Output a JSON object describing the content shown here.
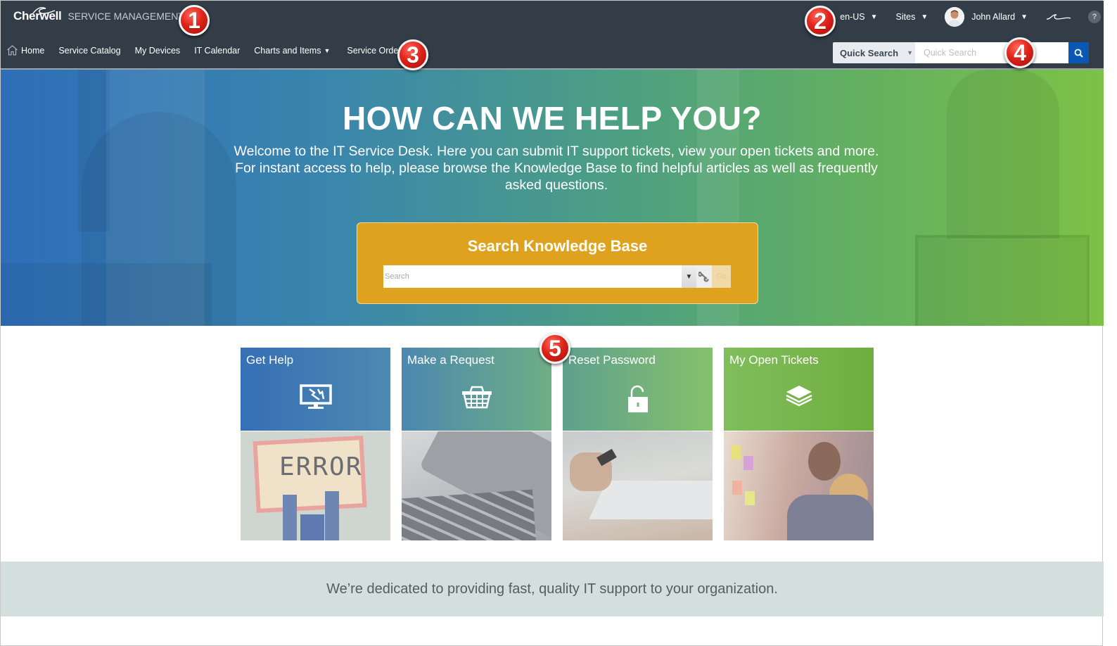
{
  "header": {
    "brand": "Cherwell",
    "product": "SERVICE MANAGEMENT",
    "locale": "en-US",
    "sites_label": "Sites",
    "user_name": "John Allard",
    "help_label": "?"
  },
  "nav": {
    "items": [
      {
        "label": "Home",
        "icon": "home-icon"
      },
      {
        "label": "Service Catalog"
      },
      {
        "label": "My Devices"
      },
      {
        "label": "IT Calendar"
      },
      {
        "label": "Charts and Items",
        "dropdown": true
      },
      {
        "label": "Service Orders",
        "dropdown": true
      }
    ]
  },
  "quick_search": {
    "scope_label": "Quick Search",
    "placeholder": "Quick Search",
    "button_icon": "search-icon"
  },
  "hero": {
    "title": "HOW CAN WE HELP YOU?",
    "line1": "Welcome to the IT Service Desk.  Here you can submit IT support tickets, view your open tickets and more.",
    "line2": "For instant access to help, please browse the Knowledge Base to find helpful articles as well as frequently asked questions."
  },
  "knowledge_base": {
    "title": "Search Knowledge Base",
    "placeholder": "Search",
    "go_label": "Go"
  },
  "tiles": [
    {
      "label": "Get Help",
      "icon": "broken-monitor-icon",
      "image": "error-sign-photo"
    },
    {
      "label": "Make a Request",
      "icon": "shopping-basket-icon",
      "image": "keyboard-tablet-photo"
    },
    {
      "label": "Reset Password",
      "icon": "unlocked-padlock-icon",
      "image": "laptop-hand-photo"
    },
    {
      "label": "My Open Tickets",
      "icon": "stacked-layers-icon",
      "image": "team-sticky-notes-photo"
    }
  ],
  "tagline": "We’re dedicated to providing fast, quality IT support to your organization.",
  "markers": [
    "1",
    "2",
    "3",
    "4",
    "5"
  ],
  "colors": {
    "topbar": "#323d48",
    "search_button": "#0a57b5",
    "kb_box": "#dea21f",
    "tile_blue": "#3a74b4",
    "tile_green": "#76b94b",
    "band": "#d3dfdd",
    "marker_red": "#e0241b"
  }
}
